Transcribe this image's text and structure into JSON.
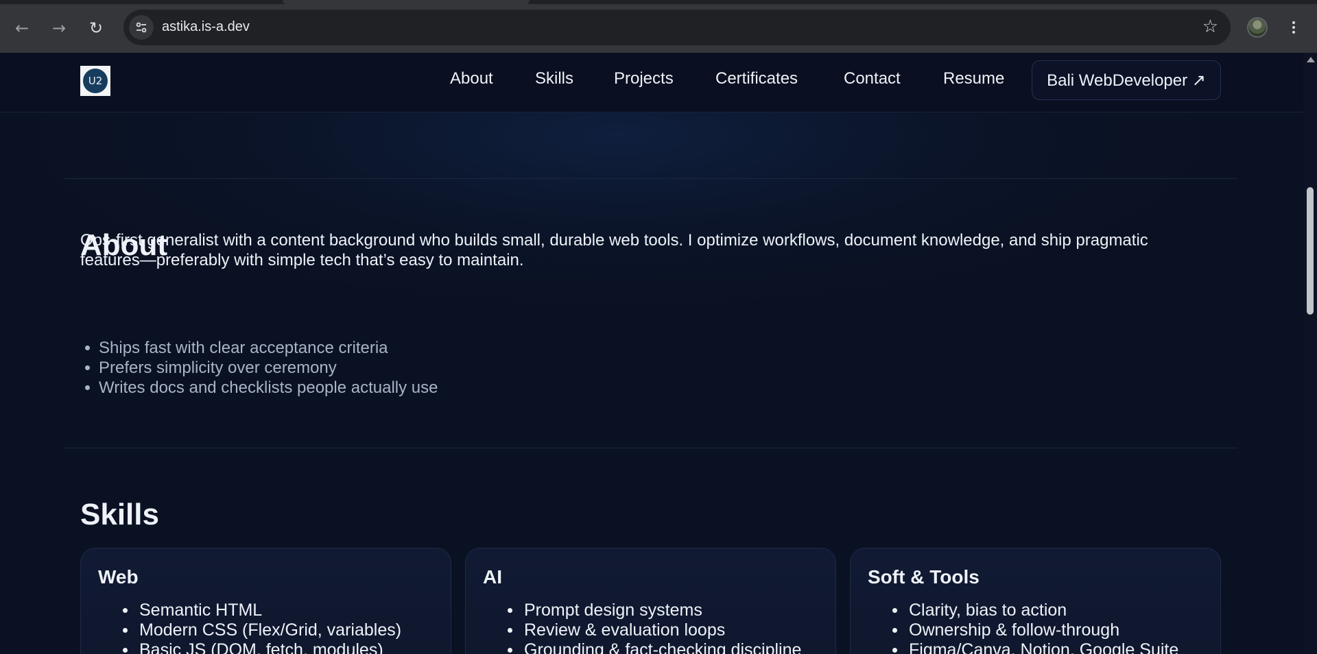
{
  "browser": {
    "url": "astika.is-a.dev"
  },
  "site": {
    "logo_text": "U2",
    "nav": [
      "About",
      "Skills",
      "Projects",
      "Certificates",
      "Contact",
      "Resume"
    ],
    "cta_label": "Bali WebDeveloper ↗"
  },
  "about": {
    "title": "About",
    "description": "Ops-first generalist with a content background who builds small, durable web tools. I optimize workflows, document knowledge, and ship pragmatic features—preferably with simple tech that’s easy to maintain.",
    "bullets": [
      "Ships fast with clear acceptance criteria",
      "Prefers simplicity over ceremony",
      "Writes docs and checklists people actually use"
    ]
  },
  "skills": {
    "title": "Skills",
    "cards": [
      {
        "title": "Web",
        "items": [
          "Semantic HTML",
          "Modern CSS (Flex/Grid, variables)",
          "Basic JS (DOM, fetch, modules)"
        ]
      },
      {
        "title": "AI",
        "items": [
          "Prompt design systems",
          "Review & evaluation loops",
          "Grounding & fact-checking discipline"
        ]
      },
      {
        "title": "Soft & Tools",
        "items": [
          "Clarity, bias to action",
          "Ownership & follow-through",
          "Figma/Canva, Notion, Google Suite"
        ]
      }
    ]
  },
  "icons": {
    "back": "back-arrow-icon",
    "forward": "forward-arrow-icon",
    "reload": "reload-icon",
    "site_info": "tune-icon",
    "bookmark": "star-icon",
    "menu": "kebab-menu-icon"
  }
}
